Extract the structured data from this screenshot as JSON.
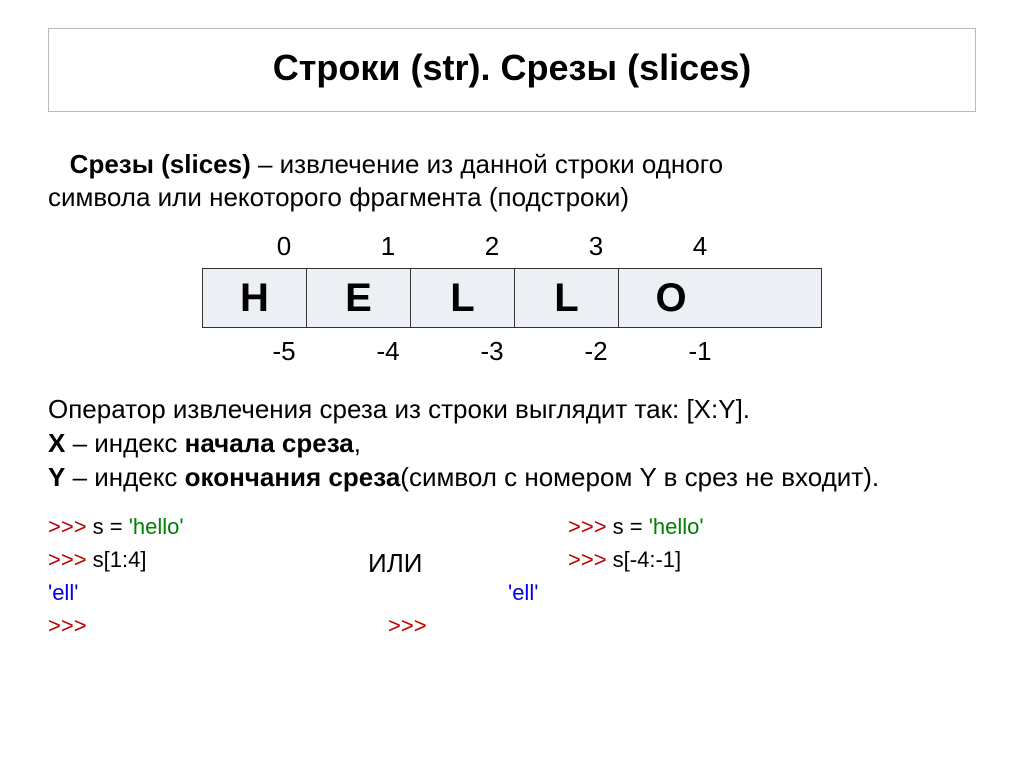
{
  "title": "Строки (str). Срезы (slices)",
  "intro": {
    "term": "Срезы (slices)",
    "rest1": " – извлечение из данной строки одного",
    "rest2": "символа или некоторого фрагмента (подстроки)"
  },
  "diagram": {
    "pos_idx": [
      "0",
      "1",
      "2",
      "3",
      "4"
    ],
    "chars": [
      "H",
      "E",
      "L",
      "L",
      "O"
    ],
    "neg_idx": [
      "-5",
      "-4",
      "-3",
      "-2",
      "-1"
    ]
  },
  "explain": {
    "line1": "Оператор извлечения среза из строки выглядит так: [X:Y].",
    "x_label": "X",
    "x_dash": " – индекс ",
    "x_bold": "начала среза",
    "x_comma": ",",
    "y_label": "Y",
    "y_dash": " – индекс ",
    "y_bold": "окончания среза",
    "y_rest": "(символ с номером Y в срез не входит)."
  },
  "code": {
    "prompt": ">>> ",
    "assign_s": "s = ",
    "hello_lit": "'hello'",
    "slice_pos": "s[1:4]",
    "slice_neg": "s[-4:-1]",
    "result": "'ell'",
    "or_word": "ИЛИ"
  }
}
